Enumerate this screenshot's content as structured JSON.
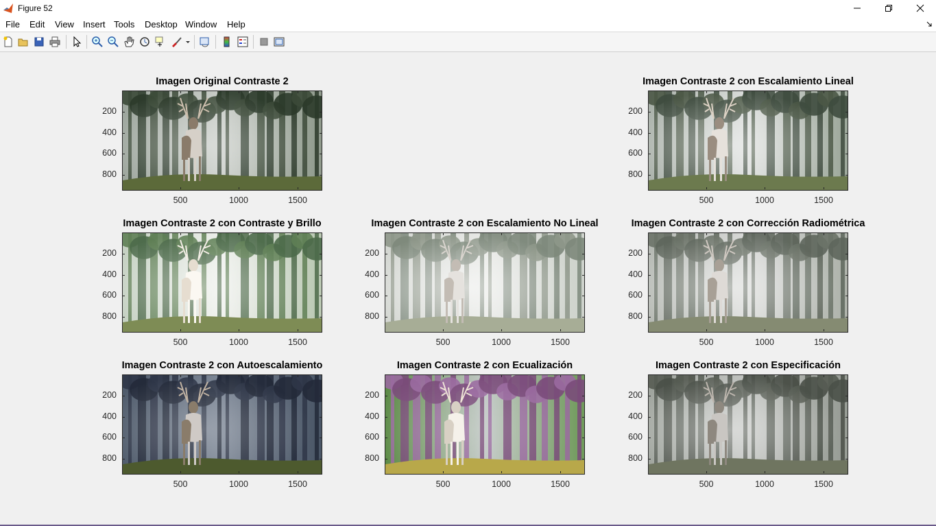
{
  "window": {
    "title": "Figure 52"
  },
  "menu": [
    "File",
    "Edit",
    "View",
    "Insert",
    "Tools",
    "Desktop",
    "Window",
    "Help"
  ],
  "toolbar": {
    "icons": [
      "new-figure-icon",
      "open-file-icon",
      "save-icon",
      "print-icon",
      "edit-plot-icon",
      "zoom-in-icon",
      "zoom-out-icon",
      "pan-icon",
      "rotate-3d-icon",
      "data-cursor-icon",
      "brush-icon",
      "link-plot-icon",
      "insert-colorbar-icon",
      "insert-legend-icon",
      "hide-plot-tools-icon",
      "show-plot-tools-icon"
    ]
  },
  "axes": {
    "yticks": [
      "200",
      "400",
      "600",
      "800"
    ],
    "xticks": [
      "500",
      "1000",
      "1500"
    ]
  },
  "subplots": [
    {
      "title": "Imagen Original Contraste 2",
      "variant": "original"
    },
    {
      "title": "Imagen Contraste 2 con Escalamiento Lineal",
      "variant": "linear"
    },
    {
      "title": "Imagen Contraste 2 con Contraste y Brillo",
      "variant": "brightness"
    },
    {
      "title": "Imagen Contraste 2 con Escalamiento No Lineal",
      "variant": "nonlinear"
    },
    {
      "title": "Imagen Contraste 2 con Corrección Radiométrica",
      "variant": "radiometric"
    },
    {
      "title": "Imagen Contraste 2 con Autoescalamiento",
      "variant": "auto"
    },
    {
      "title": "Imagen Contraste 2 con Ecualización",
      "variant": "equalized"
    },
    {
      "title": "Imagen Contraste 2 con Especificación",
      "variant": "specification"
    }
  ]
}
